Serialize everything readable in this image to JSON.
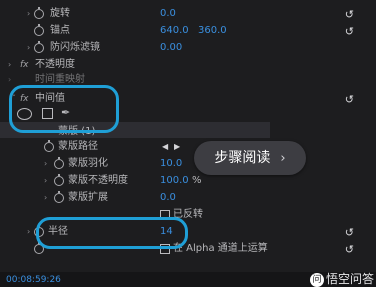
{
  "rows": {
    "rotation": {
      "label": "旋转",
      "value": "0.0"
    },
    "anchor": {
      "label": "锚点",
      "value_x": "640.0",
      "value_y": "360.0"
    },
    "anti_flicker": {
      "label": "防闪烁滤镜",
      "value": "0.00"
    },
    "opacity": {
      "fx": "fx",
      "label": "不透明度"
    },
    "time_remap": {
      "label": "时间重映射"
    },
    "median": {
      "fx": "fx",
      "label": "中间值"
    },
    "mask": {
      "label": "蒙版 (1)"
    },
    "mask_path": {
      "label": "蒙版路径"
    },
    "mask_feather": {
      "label": "蒙版羽化",
      "value": "10.0"
    },
    "mask_opacity": {
      "label": "蒙版不透明度",
      "value": "100.0",
      "unit": "%"
    },
    "mask_expansion": {
      "label": "蒙版扩展",
      "value": "0.0"
    },
    "inverted": {
      "label": "已反转"
    },
    "radius": {
      "label": "半径",
      "value": "14"
    },
    "alpha": {
      "label": "在 Alpha 通道上运算"
    }
  },
  "overlay": {
    "step_button": "步骤阅读",
    "step_chevron": "›"
  },
  "footer": {
    "timecode": "00:08:59:26",
    "watermark": "悟空问答",
    "watermark_icon": "问"
  },
  "icons": {
    "reset": "↺",
    "nav_prev": "◀",
    "nav_next": "▶",
    "pen": "✒"
  },
  "colors": {
    "value_blue": "#3a8fdf",
    "highlight": "#1f9fd6"
  }
}
